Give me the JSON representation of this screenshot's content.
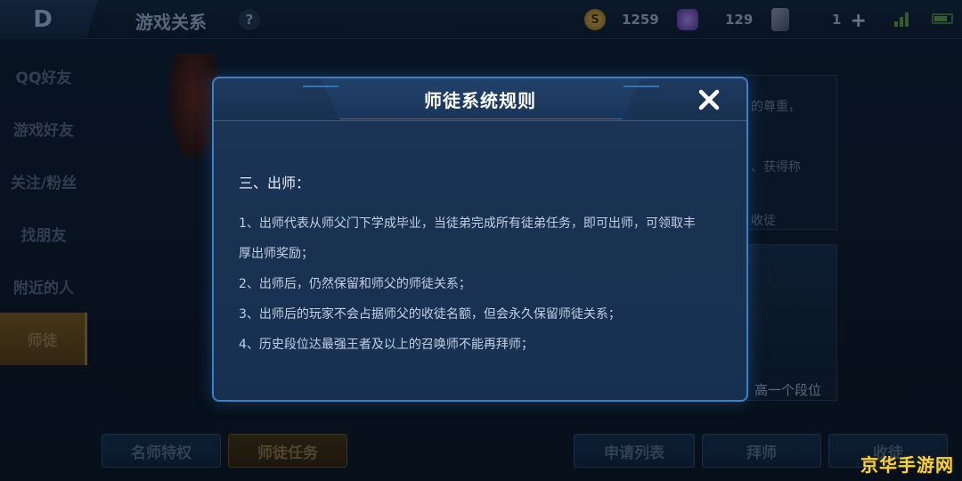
{
  "header": {
    "back_glyph": "D",
    "title": "游戏关系",
    "help": "?",
    "resources": {
      "coins": "1259",
      "gems": "129",
      "cards": "1"
    }
  },
  "sidebar": {
    "items": [
      {
        "label": "QQ好友"
      },
      {
        "label": "游戏好友"
      },
      {
        "label": "关注/粉丝"
      },
      {
        "label": "找朋友"
      },
      {
        "label": "附近的人"
      },
      {
        "label": "师徒"
      }
    ]
  },
  "background_panel": {
    "text1": "的尊重，",
    "text2": "、获得称",
    "text3": "收徒",
    "text4": "高一个段位"
  },
  "bottom_buttons": {
    "master_privilege": "名师特权",
    "mentor_tasks": "师徒任务",
    "apply_list": "申请列表",
    "become_apprentice": "拜师",
    "take_apprentice": "收徒"
  },
  "dialog": {
    "title": "师徒系统规则",
    "section_heading": "三、出师：",
    "rules": [
      "1、出师代表从师父门下学成毕业，当徒弟完成所有徒弟任务，即可出师，可领取丰",
      "厚出师奖励；",
      "2、出师后，仍然保留和师父的师徒关系；",
      "3、出师后的玩家不会占据师父的收徒名额，但会永久保留师徒关系；",
      "4、历史段位达最强王者及以上的召唤师不能再拜师；"
    ]
  },
  "watermark": "京华手游网",
  "colors": {
    "dialog_border": "#3f7fc4",
    "dialog_bg": "#1a3252",
    "title_text": "#ffffff",
    "watermark": "#f6d24a"
  }
}
